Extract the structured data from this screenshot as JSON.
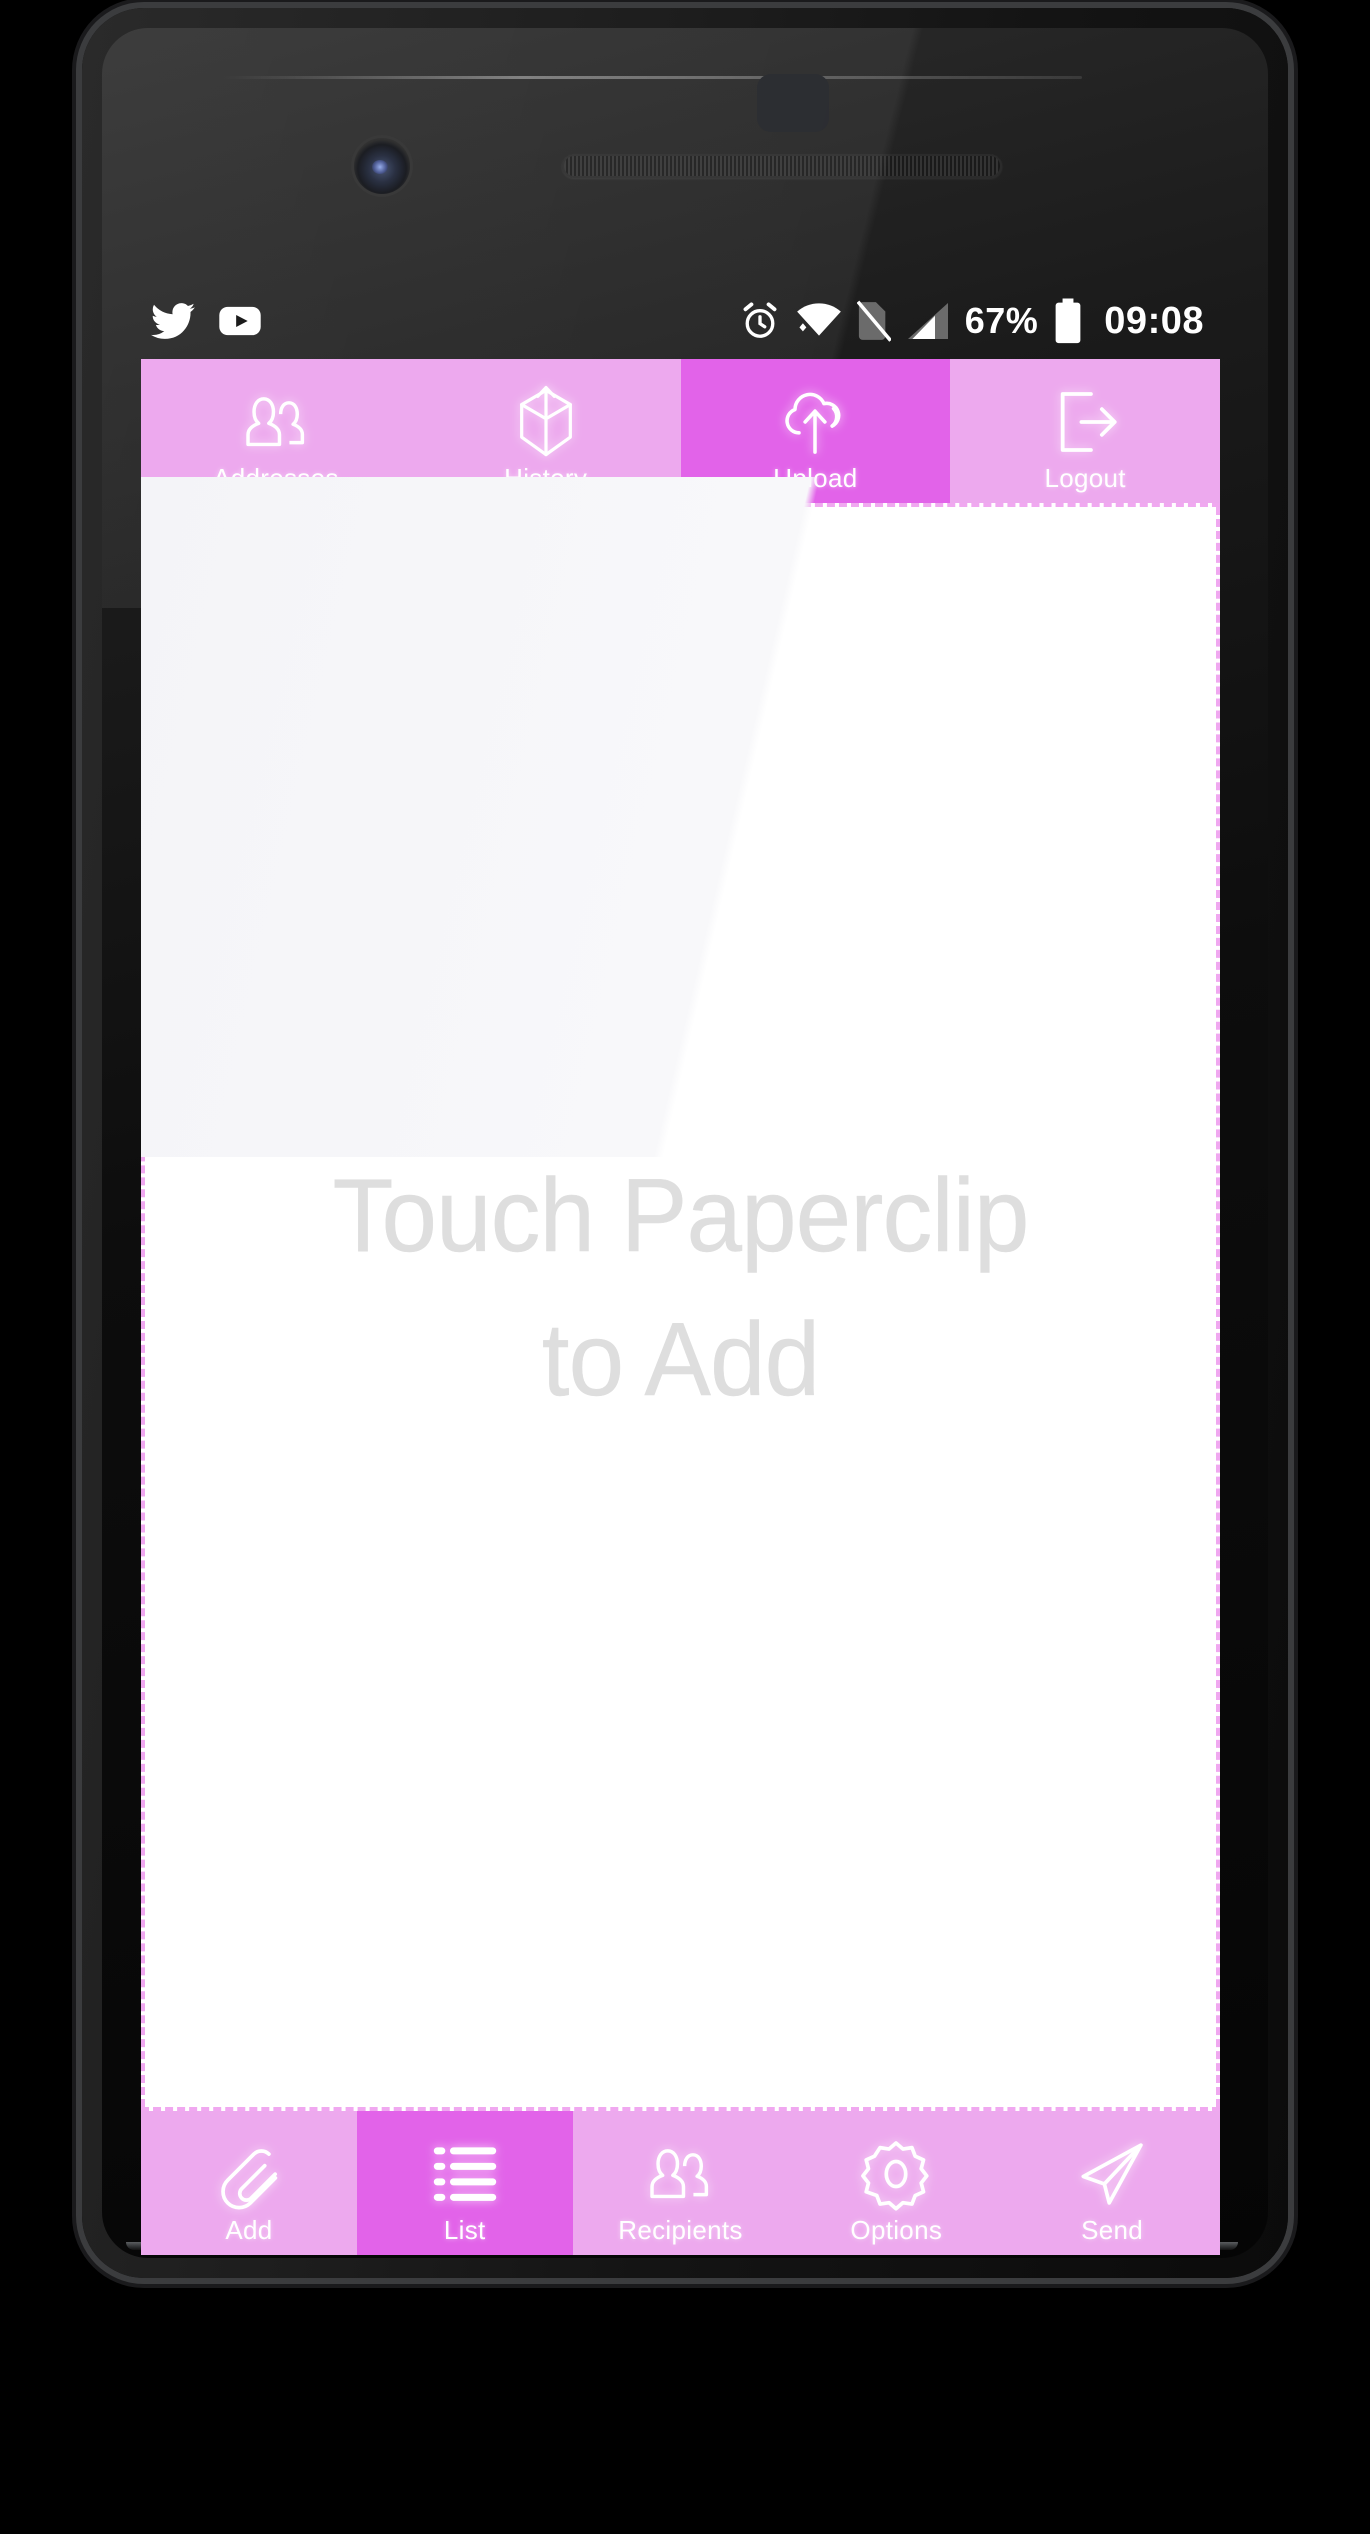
{
  "device": {
    "kind": "android-phone-mockup",
    "frame_color": "#1a1a1c"
  },
  "status_bar": {
    "notification_icons": [
      "twitter-icon",
      "youtube-icon"
    ],
    "alarm_icon": "alarm-clock-icon",
    "wifi_icon": "wifi-icon",
    "no_sim_icon": "no-sim-icon",
    "signal_icon": "cellular-signal-icon",
    "battery_percent": "67%",
    "battery_icon": "battery-icon",
    "clock": "09:08",
    "text_color": "#ffffff",
    "background_color": "#000000"
  },
  "theme": {
    "accent_inactive": "#eda9ee",
    "accent_active": "#e263e9",
    "border_dashed": "#f0a8f0",
    "label_color": "#ffffff",
    "placeholder_color": "#dedede"
  },
  "top_nav": {
    "items": [
      {
        "label": "Addresses",
        "icon": "people-icon",
        "active": false
      },
      {
        "label": "History",
        "icon": "box-arrow-up-icon",
        "active": false
      },
      {
        "label": "Upload",
        "icon": "cloud-upload-icon",
        "active": true
      },
      {
        "label": "Logout",
        "icon": "exit-arrow-icon",
        "active": false
      }
    ]
  },
  "content": {
    "placeholder_line1": "Touch Paperclip",
    "placeholder_line2": "to Add",
    "background_color": "#ffffff"
  },
  "bottom_nav": {
    "items": [
      {
        "label": "Add",
        "icon": "paperclip-icon",
        "active": false
      },
      {
        "label": "List",
        "icon": "list-icon",
        "active": true
      },
      {
        "label": "Recipients",
        "icon": "people-icon",
        "active": false
      },
      {
        "label": "Options",
        "icon": "gear-icon",
        "active": false
      },
      {
        "label": "Send",
        "icon": "paper-plane-icon",
        "active": false
      }
    ]
  }
}
